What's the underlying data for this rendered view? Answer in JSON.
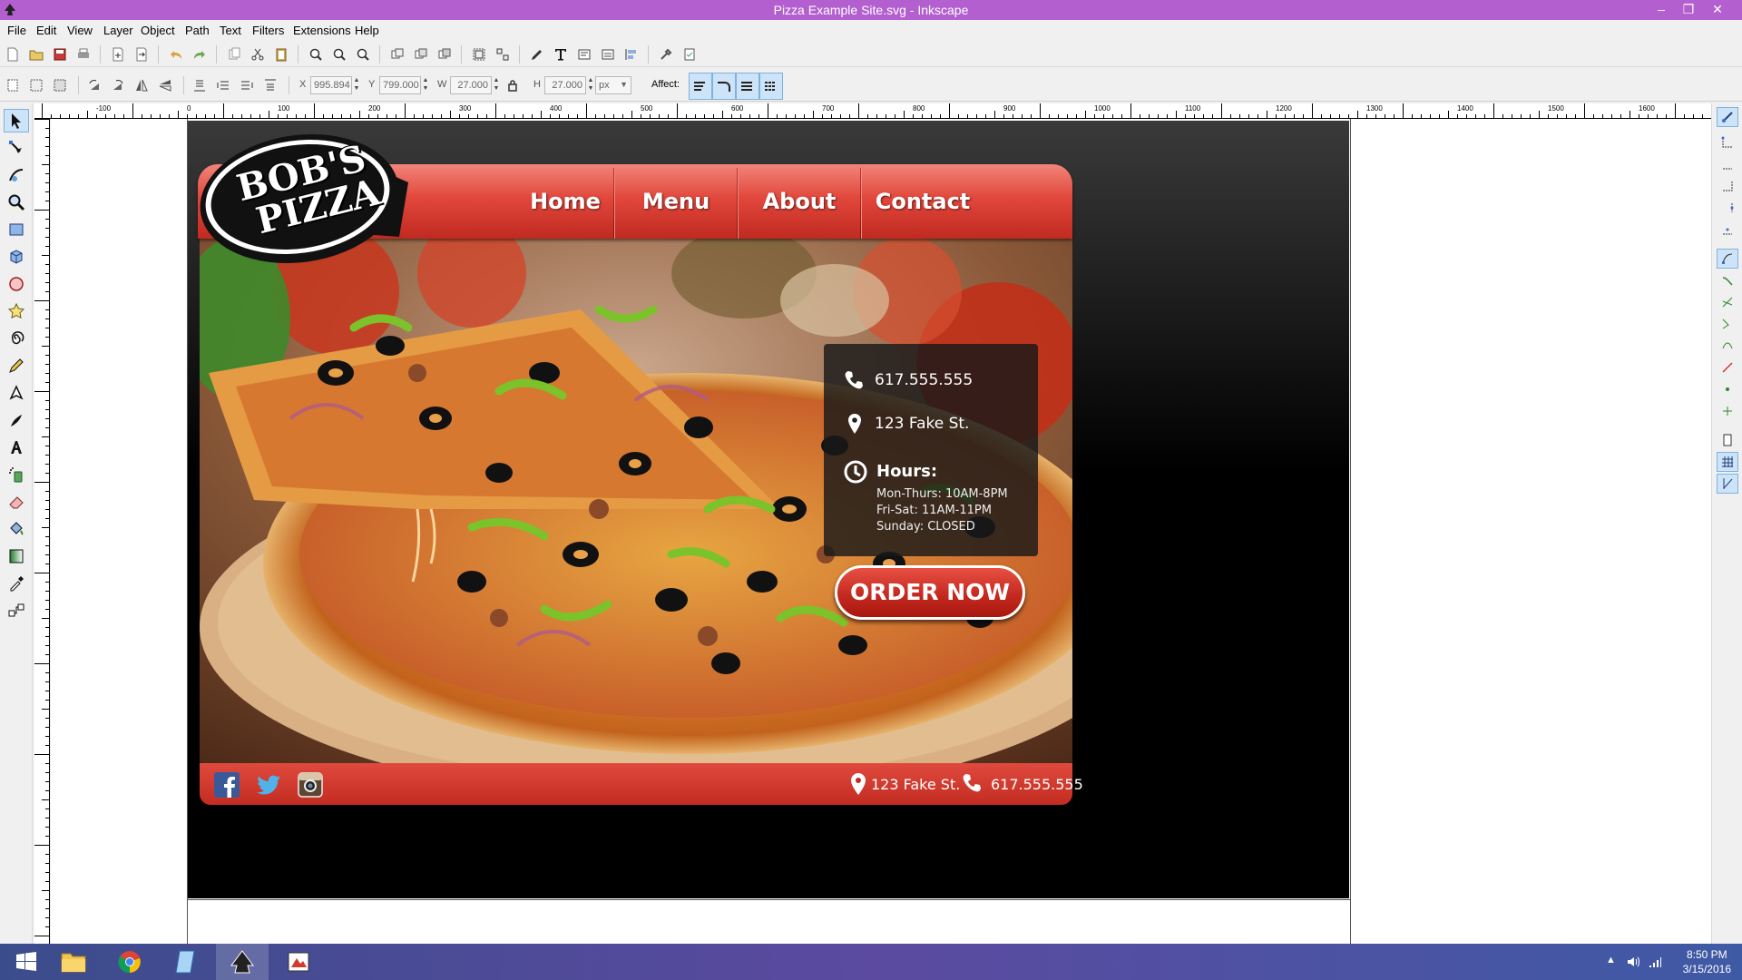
{
  "window": {
    "title": "Pizza Example Site.svg - Inkscape"
  },
  "menubar": {
    "items": [
      "File",
      "Edit",
      "View",
      "Layer",
      "Object",
      "Path",
      "Text",
      "Filters",
      "Extensions",
      "Help"
    ]
  },
  "controls": {
    "x_label": "X",
    "x_value": "995.894",
    "y_label": "Y",
    "y_value": "799.000",
    "w_label": "W",
    "w_value": "27.000",
    "h_label": "H",
    "h_value": "27.000",
    "unit": "px",
    "affect_label": "Affect:"
  },
  "ruler": {
    "labels": [
      "-100",
      "0",
      "100",
      "200",
      "300",
      "400",
      "500",
      "600",
      "700",
      "800",
      "900",
      "1000",
      "1100",
      "1200",
      "1300",
      "1400",
      "1500",
      "1600"
    ]
  },
  "site": {
    "logo_line1": "BOB'S",
    "logo_line2": "PIZZA",
    "nav": [
      "Home",
      "Menu",
      "About",
      "Contact"
    ],
    "phone": "617.555.555",
    "address": "123 Fake St.",
    "hours_title": "Hours:",
    "hours": [
      "Mon-Thurs:  10AM-8PM",
      "Fri-Sat:  11AM-11PM",
      "Sunday:  CLOSED"
    ],
    "order_button": "ORDER NOW",
    "footer_address": "123 Fake St.",
    "footer_phone": "617.555.555"
  },
  "taskbar": {
    "time": "8:50 PM",
    "date": "3/15/2016"
  },
  "colors": {
    "titlebar": "#b35fd0",
    "brand_red": "#d23a2e",
    "selection": "#cde3f7"
  }
}
